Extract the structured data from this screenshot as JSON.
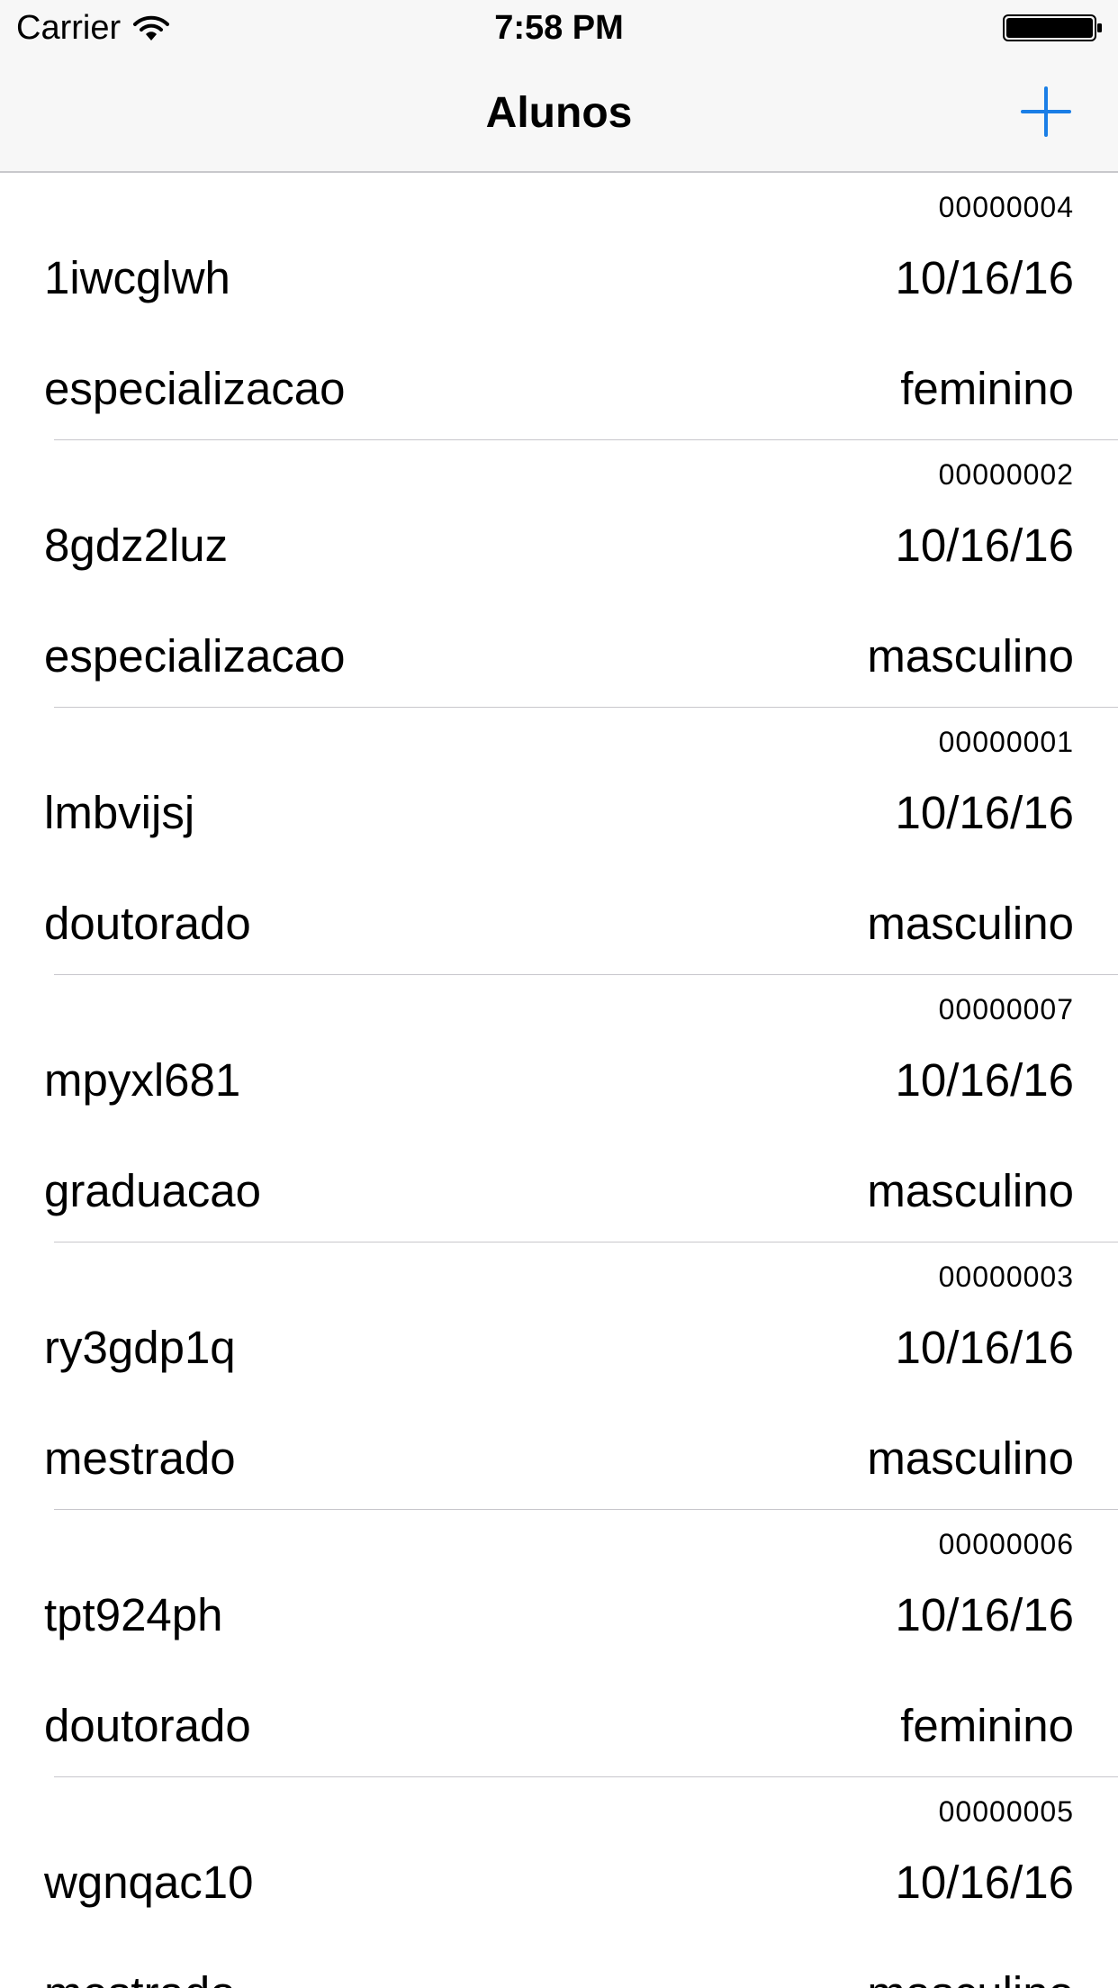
{
  "status_bar": {
    "carrier": "Carrier",
    "time": "7:58 PM",
    "icons": [
      "wifi-icon",
      "battery-icon"
    ]
  },
  "nav": {
    "title": "Alunos",
    "add_icon": "plus-icon",
    "accent_color": "#1a7ee6"
  },
  "students": [
    {
      "id": "00000004",
      "name": "1iwcglwh",
      "date": "10/16/16",
      "level": "especializacao",
      "gender": "feminino"
    },
    {
      "id": "00000002",
      "name": "8gdz2luz",
      "date": "10/16/16",
      "level": "especializacao",
      "gender": "masculino"
    },
    {
      "id": "00000001",
      "name": "lmbvijsj",
      "date": "10/16/16",
      "level": "doutorado",
      "gender": "masculino"
    },
    {
      "id": "00000007",
      "name": "mpyxl681",
      "date": "10/16/16",
      "level": "graduacao",
      "gender": "masculino"
    },
    {
      "id": "00000003",
      "name": "ry3gdp1q",
      "date": "10/16/16",
      "level": "mestrado",
      "gender": "masculino"
    },
    {
      "id": "00000006",
      "name": "tpt924ph",
      "date": "10/16/16",
      "level": "doutorado",
      "gender": "feminino"
    },
    {
      "id": "00000005",
      "name": "wgnqac10",
      "date": "10/16/16",
      "level": "mestrado",
      "gender": "masculino"
    }
  ]
}
